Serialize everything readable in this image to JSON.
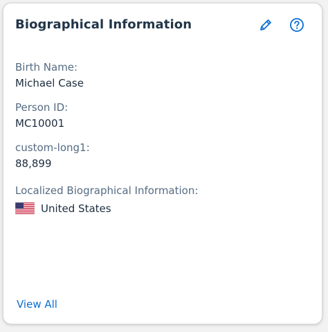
{
  "card": {
    "title": "Biographical Information",
    "edit_icon": "pencil-icon",
    "help_icon": "help-circle-icon",
    "accent_color": "#0a6ed1"
  },
  "fields": [
    {
      "label": "Birth Name:",
      "value": "Michael Case"
    },
    {
      "label": "Person ID:",
      "value": "MC10001"
    },
    {
      "label": "custom-long1:",
      "value": "88,899"
    }
  ],
  "localized": {
    "label": "Localized Biographical Information:",
    "flag_icon": "us-flag-icon",
    "country": "United States"
  },
  "footer": {
    "link": "View All"
  }
}
